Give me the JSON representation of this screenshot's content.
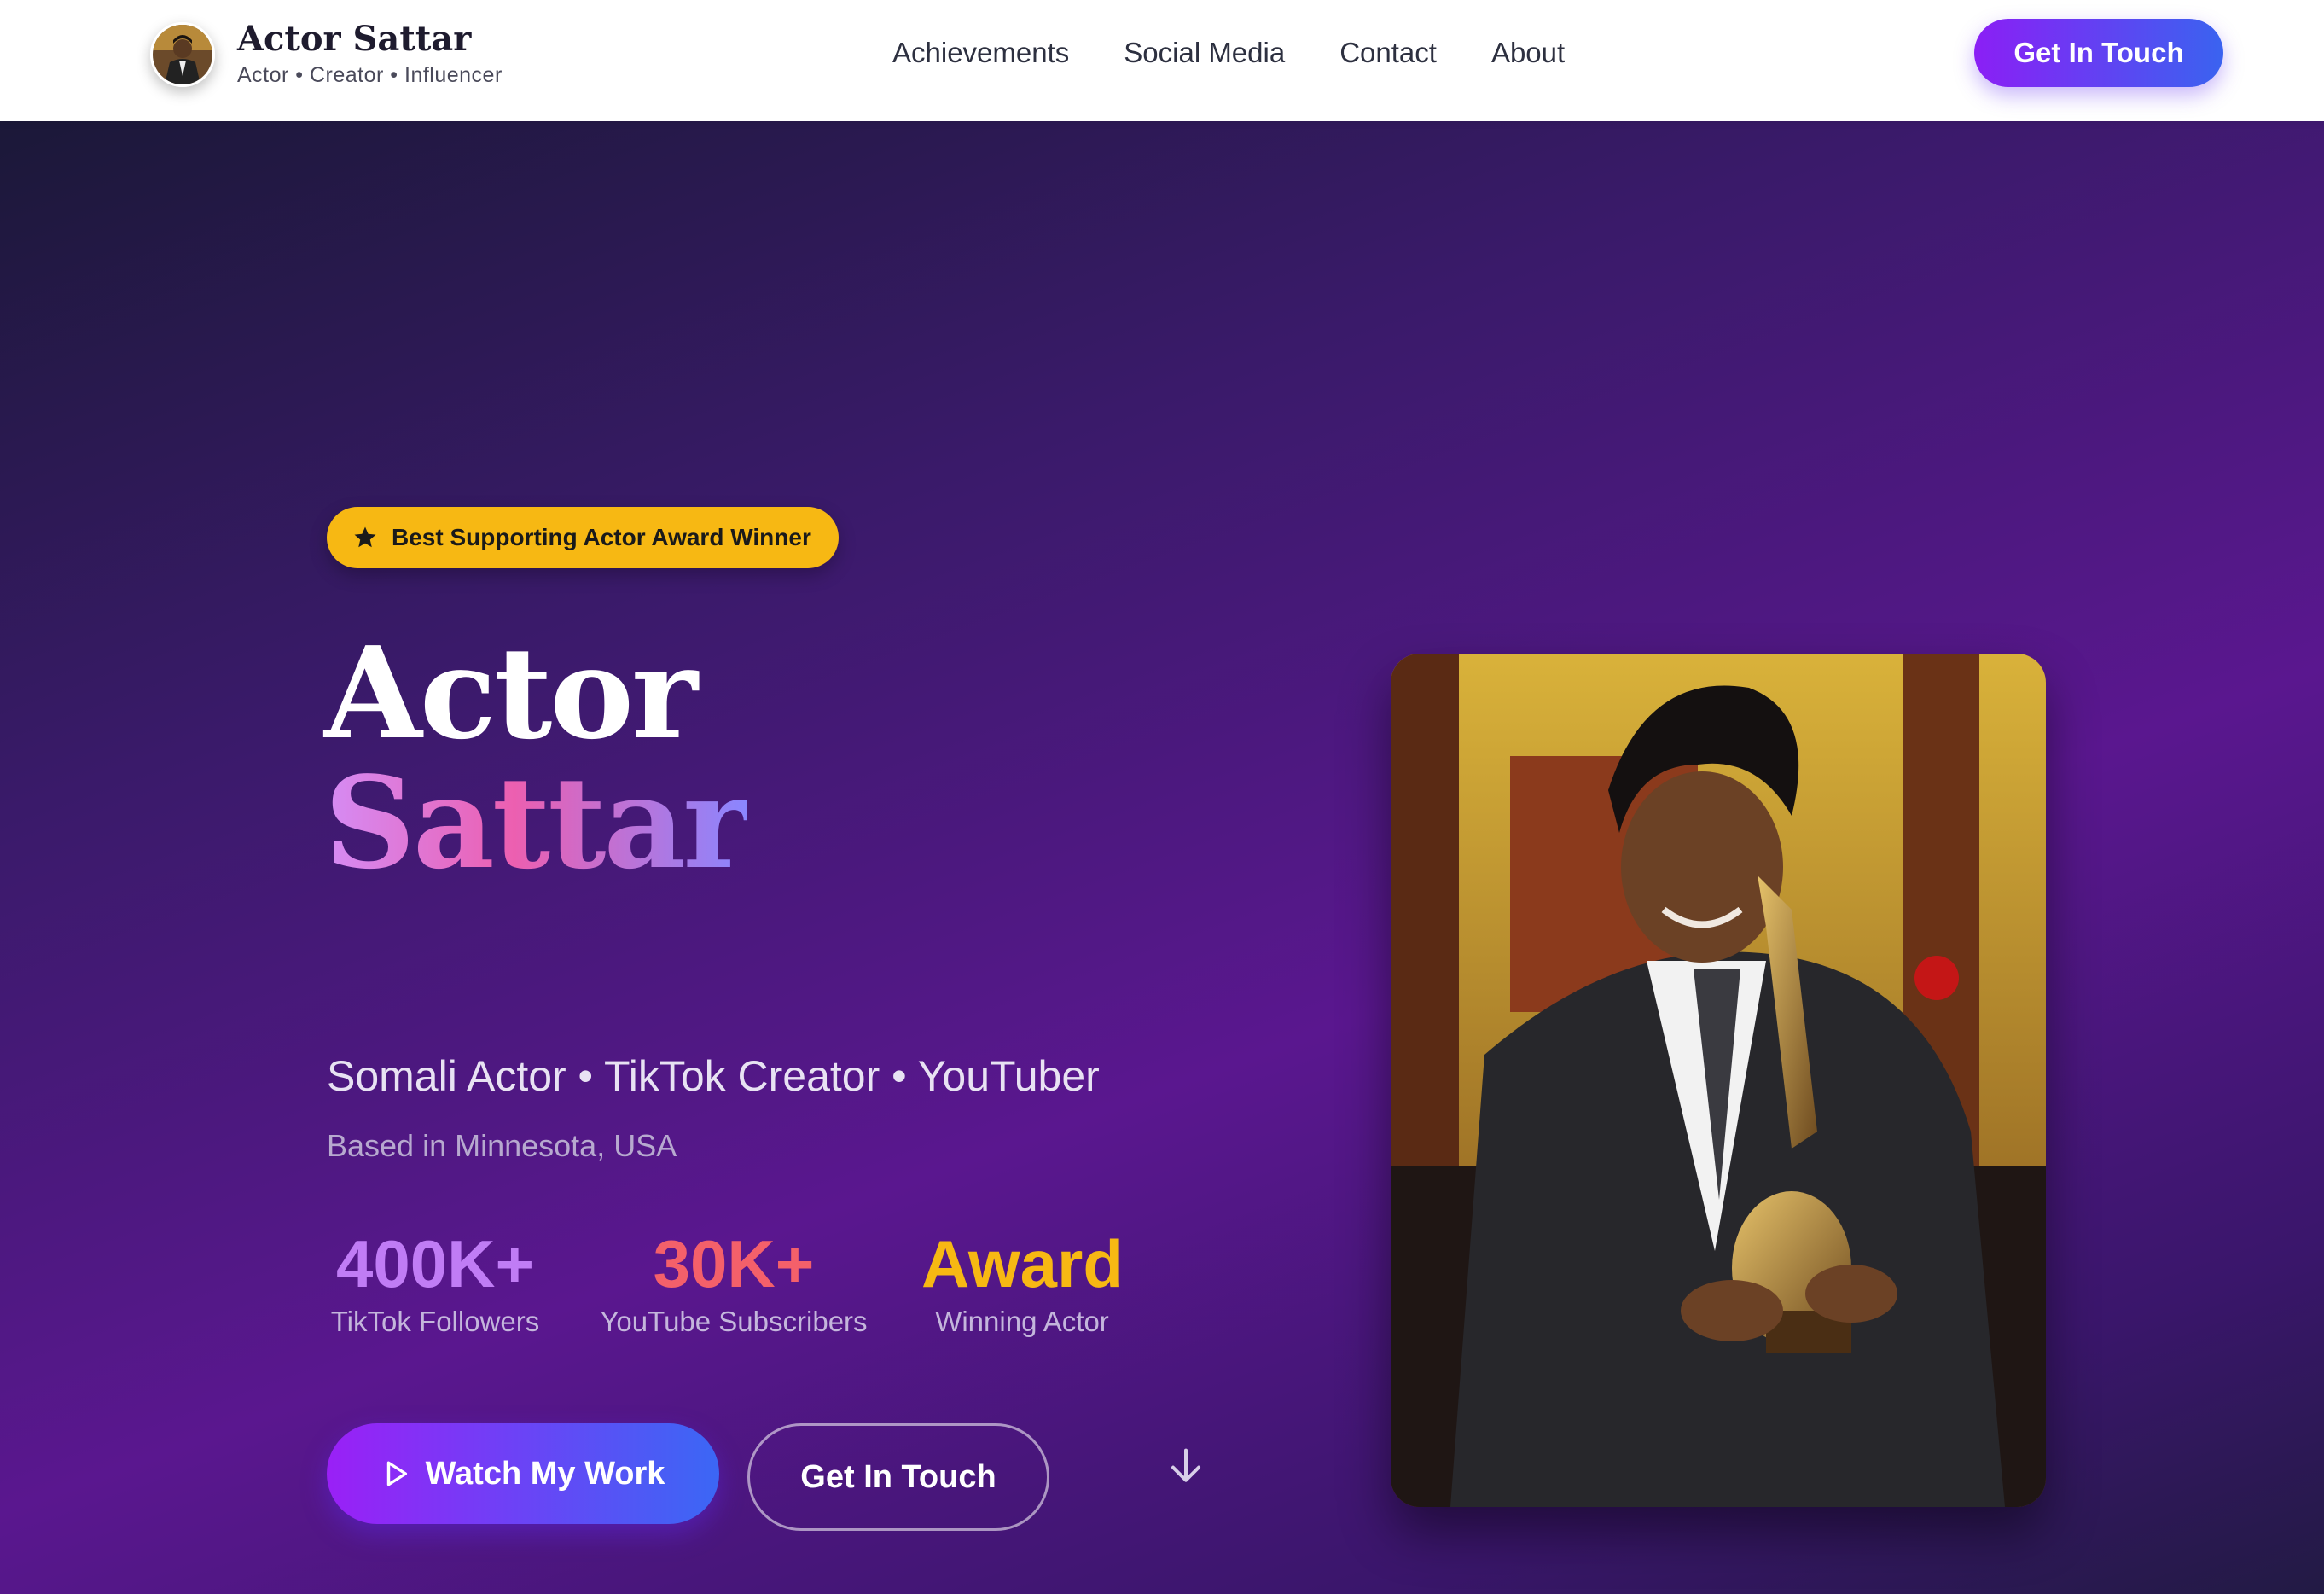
{
  "header": {
    "brand_name": "Actor Sattar",
    "brand_tagline": "Actor • Creator • Influencer",
    "nav": [
      "Achievements",
      "Social Media",
      "Contact",
      "About"
    ],
    "cta_label": "Get In Touch"
  },
  "hero": {
    "badge_icon": "star-icon",
    "badge_text": "Best Supporting Actor Award Winner",
    "name_first": "Actor",
    "name_last": "Sattar",
    "roles": "Somali Actor • TikTok Creator • YouTuber",
    "location": "Based in Minnesota, USA",
    "stats": [
      {
        "value": "400K+",
        "label": "TikTok Followers",
        "color": "#c07cf5"
      },
      {
        "value": "30K+",
        "label": "YouTube Subscribers",
        "color": "#f4606a"
      },
      {
        "value": "Award",
        "label": "Winning Actor",
        "color": "#f7b813"
      }
    ],
    "primary_button": "Watch My Work",
    "secondary_button": "Get In Touch",
    "scroll_icon": "arrow-down-icon"
  },
  "colors": {
    "accent_gradient_start": "#8b1ff5",
    "accent_gradient_end": "#3a63f0",
    "badge": "#f7b813",
    "hero_bg": "#4a1a7e"
  }
}
